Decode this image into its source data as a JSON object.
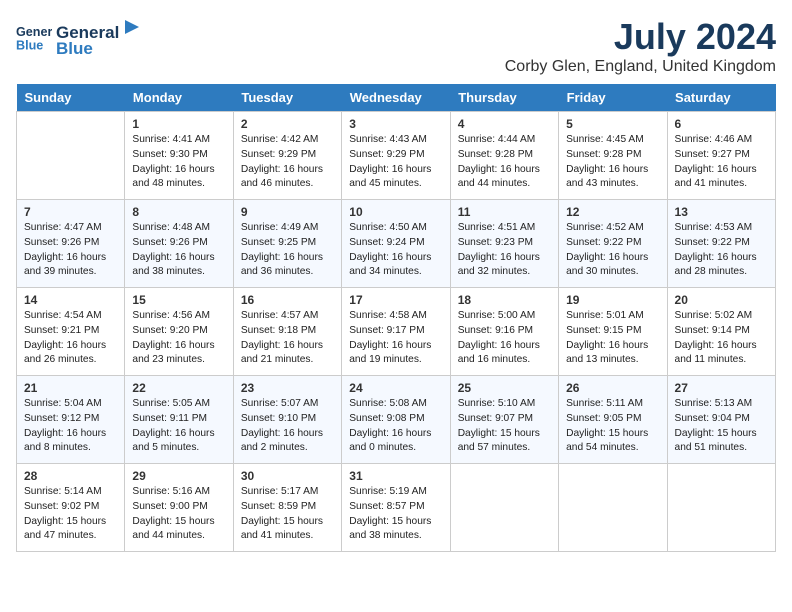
{
  "header": {
    "logo_line1": "General",
    "logo_line2": "Blue",
    "month_title": "July 2024",
    "location": "Corby Glen, England, United Kingdom"
  },
  "weekdays": [
    "Sunday",
    "Monday",
    "Tuesday",
    "Wednesday",
    "Thursday",
    "Friday",
    "Saturday"
  ],
  "weeks": [
    [
      {
        "day": "",
        "info": ""
      },
      {
        "day": "1",
        "info": "Sunrise: 4:41 AM\nSunset: 9:30 PM\nDaylight: 16 hours\nand 48 minutes."
      },
      {
        "day": "2",
        "info": "Sunrise: 4:42 AM\nSunset: 9:29 PM\nDaylight: 16 hours\nand 46 minutes."
      },
      {
        "day": "3",
        "info": "Sunrise: 4:43 AM\nSunset: 9:29 PM\nDaylight: 16 hours\nand 45 minutes."
      },
      {
        "day": "4",
        "info": "Sunrise: 4:44 AM\nSunset: 9:28 PM\nDaylight: 16 hours\nand 44 minutes."
      },
      {
        "day": "5",
        "info": "Sunrise: 4:45 AM\nSunset: 9:28 PM\nDaylight: 16 hours\nand 43 minutes."
      },
      {
        "day": "6",
        "info": "Sunrise: 4:46 AM\nSunset: 9:27 PM\nDaylight: 16 hours\nand 41 minutes."
      }
    ],
    [
      {
        "day": "7",
        "info": "Sunrise: 4:47 AM\nSunset: 9:26 PM\nDaylight: 16 hours\nand 39 minutes."
      },
      {
        "day": "8",
        "info": "Sunrise: 4:48 AM\nSunset: 9:26 PM\nDaylight: 16 hours\nand 38 minutes."
      },
      {
        "day": "9",
        "info": "Sunrise: 4:49 AM\nSunset: 9:25 PM\nDaylight: 16 hours\nand 36 minutes."
      },
      {
        "day": "10",
        "info": "Sunrise: 4:50 AM\nSunset: 9:24 PM\nDaylight: 16 hours\nand 34 minutes."
      },
      {
        "day": "11",
        "info": "Sunrise: 4:51 AM\nSunset: 9:23 PM\nDaylight: 16 hours\nand 32 minutes."
      },
      {
        "day": "12",
        "info": "Sunrise: 4:52 AM\nSunset: 9:22 PM\nDaylight: 16 hours\nand 30 minutes."
      },
      {
        "day": "13",
        "info": "Sunrise: 4:53 AM\nSunset: 9:22 PM\nDaylight: 16 hours\nand 28 minutes."
      }
    ],
    [
      {
        "day": "14",
        "info": "Sunrise: 4:54 AM\nSunset: 9:21 PM\nDaylight: 16 hours\nand 26 minutes."
      },
      {
        "day": "15",
        "info": "Sunrise: 4:56 AM\nSunset: 9:20 PM\nDaylight: 16 hours\nand 23 minutes."
      },
      {
        "day": "16",
        "info": "Sunrise: 4:57 AM\nSunset: 9:18 PM\nDaylight: 16 hours\nand 21 minutes."
      },
      {
        "day": "17",
        "info": "Sunrise: 4:58 AM\nSunset: 9:17 PM\nDaylight: 16 hours\nand 19 minutes."
      },
      {
        "day": "18",
        "info": "Sunrise: 5:00 AM\nSunset: 9:16 PM\nDaylight: 16 hours\nand 16 minutes."
      },
      {
        "day": "19",
        "info": "Sunrise: 5:01 AM\nSunset: 9:15 PM\nDaylight: 16 hours\nand 13 minutes."
      },
      {
        "day": "20",
        "info": "Sunrise: 5:02 AM\nSunset: 9:14 PM\nDaylight: 16 hours\nand 11 minutes."
      }
    ],
    [
      {
        "day": "21",
        "info": "Sunrise: 5:04 AM\nSunset: 9:12 PM\nDaylight: 16 hours\nand 8 minutes."
      },
      {
        "day": "22",
        "info": "Sunrise: 5:05 AM\nSunset: 9:11 PM\nDaylight: 16 hours\nand 5 minutes."
      },
      {
        "day": "23",
        "info": "Sunrise: 5:07 AM\nSunset: 9:10 PM\nDaylight: 16 hours\nand 2 minutes."
      },
      {
        "day": "24",
        "info": "Sunrise: 5:08 AM\nSunset: 9:08 PM\nDaylight: 16 hours\nand 0 minutes."
      },
      {
        "day": "25",
        "info": "Sunrise: 5:10 AM\nSunset: 9:07 PM\nDaylight: 15 hours\nand 57 minutes."
      },
      {
        "day": "26",
        "info": "Sunrise: 5:11 AM\nSunset: 9:05 PM\nDaylight: 15 hours\nand 54 minutes."
      },
      {
        "day": "27",
        "info": "Sunrise: 5:13 AM\nSunset: 9:04 PM\nDaylight: 15 hours\nand 51 minutes."
      }
    ],
    [
      {
        "day": "28",
        "info": "Sunrise: 5:14 AM\nSunset: 9:02 PM\nDaylight: 15 hours\nand 47 minutes."
      },
      {
        "day": "29",
        "info": "Sunrise: 5:16 AM\nSunset: 9:00 PM\nDaylight: 15 hours\nand 44 minutes."
      },
      {
        "day": "30",
        "info": "Sunrise: 5:17 AM\nSunset: 8:59 PM\nDaylight: 15 hours\nand 41 minutes."
      },
      {
        "day": "31",
        "info": "Sunrise: 5:19 AM\nSunset: 8:57 PM\nDaylight: 15 hours\nand 38 minutes."
      },
      {
        "day": "",
        "info": ""
      },
      {
        "day": "",
        "info": ""
      },
      {
        "day": "",
        "info": ""
      }
    ]
  ]
}
